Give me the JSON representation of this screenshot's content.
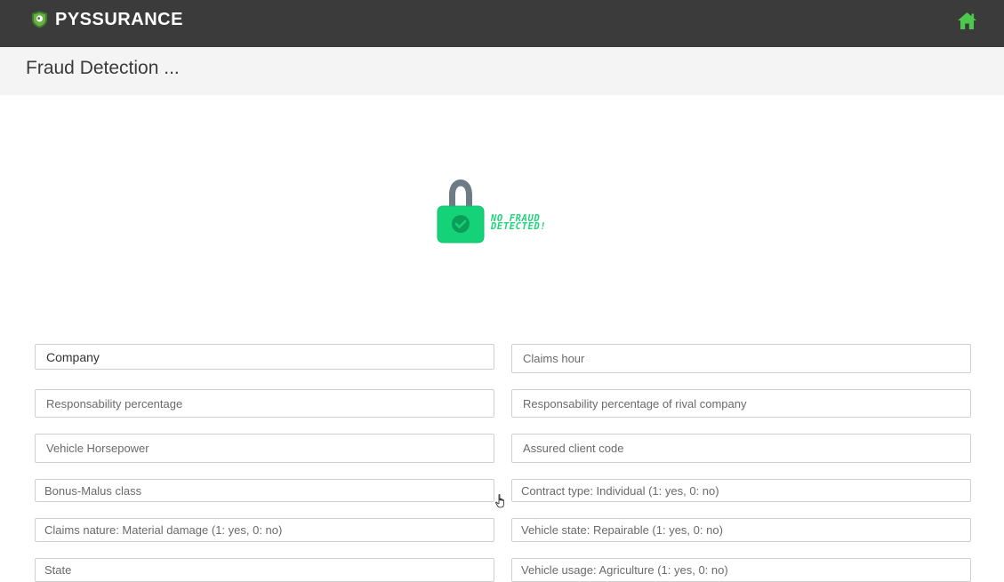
{
  "brand": {
    "name": "PYSSURANCE"
  },
  "header": {
    "title": "Fraud Detection ..."
  },
  "result": {
    "line1": "NO FRAUD",
    "line2": "DETECTED!"
  },
  "form": {
    "company_value": "Company",
    "claims_hour": "Claims hour",
    "responsability_percentage": "Responsability percentage",
    "responsability_rival": "Responsability percentage of rival company",
    "vehicle_horsepower": "Vehicle Horsepower",
    "assured_client_code": "Assured client code",
    "bonus_malus": "Bonus-Malus class",
    "contract_type": "Contract type: Individual (1: yes, 0: no)",
    "claims_nature": "Claims nature: Material damage (1: yes, 0: no)",
    "vehicle_state": "Vehicle state: Repairable (1: yes, 0: no)",
    "state": "State",
    "vehicle_usage": "Vehicle usage: Agriculture (1: yes, 0: no)"
  },
  "colors": {
    "topbar": "#3b3b3b",
    "accent_green": "#1fd47a",
    "home_green": "#4cc94c"
  }
}
